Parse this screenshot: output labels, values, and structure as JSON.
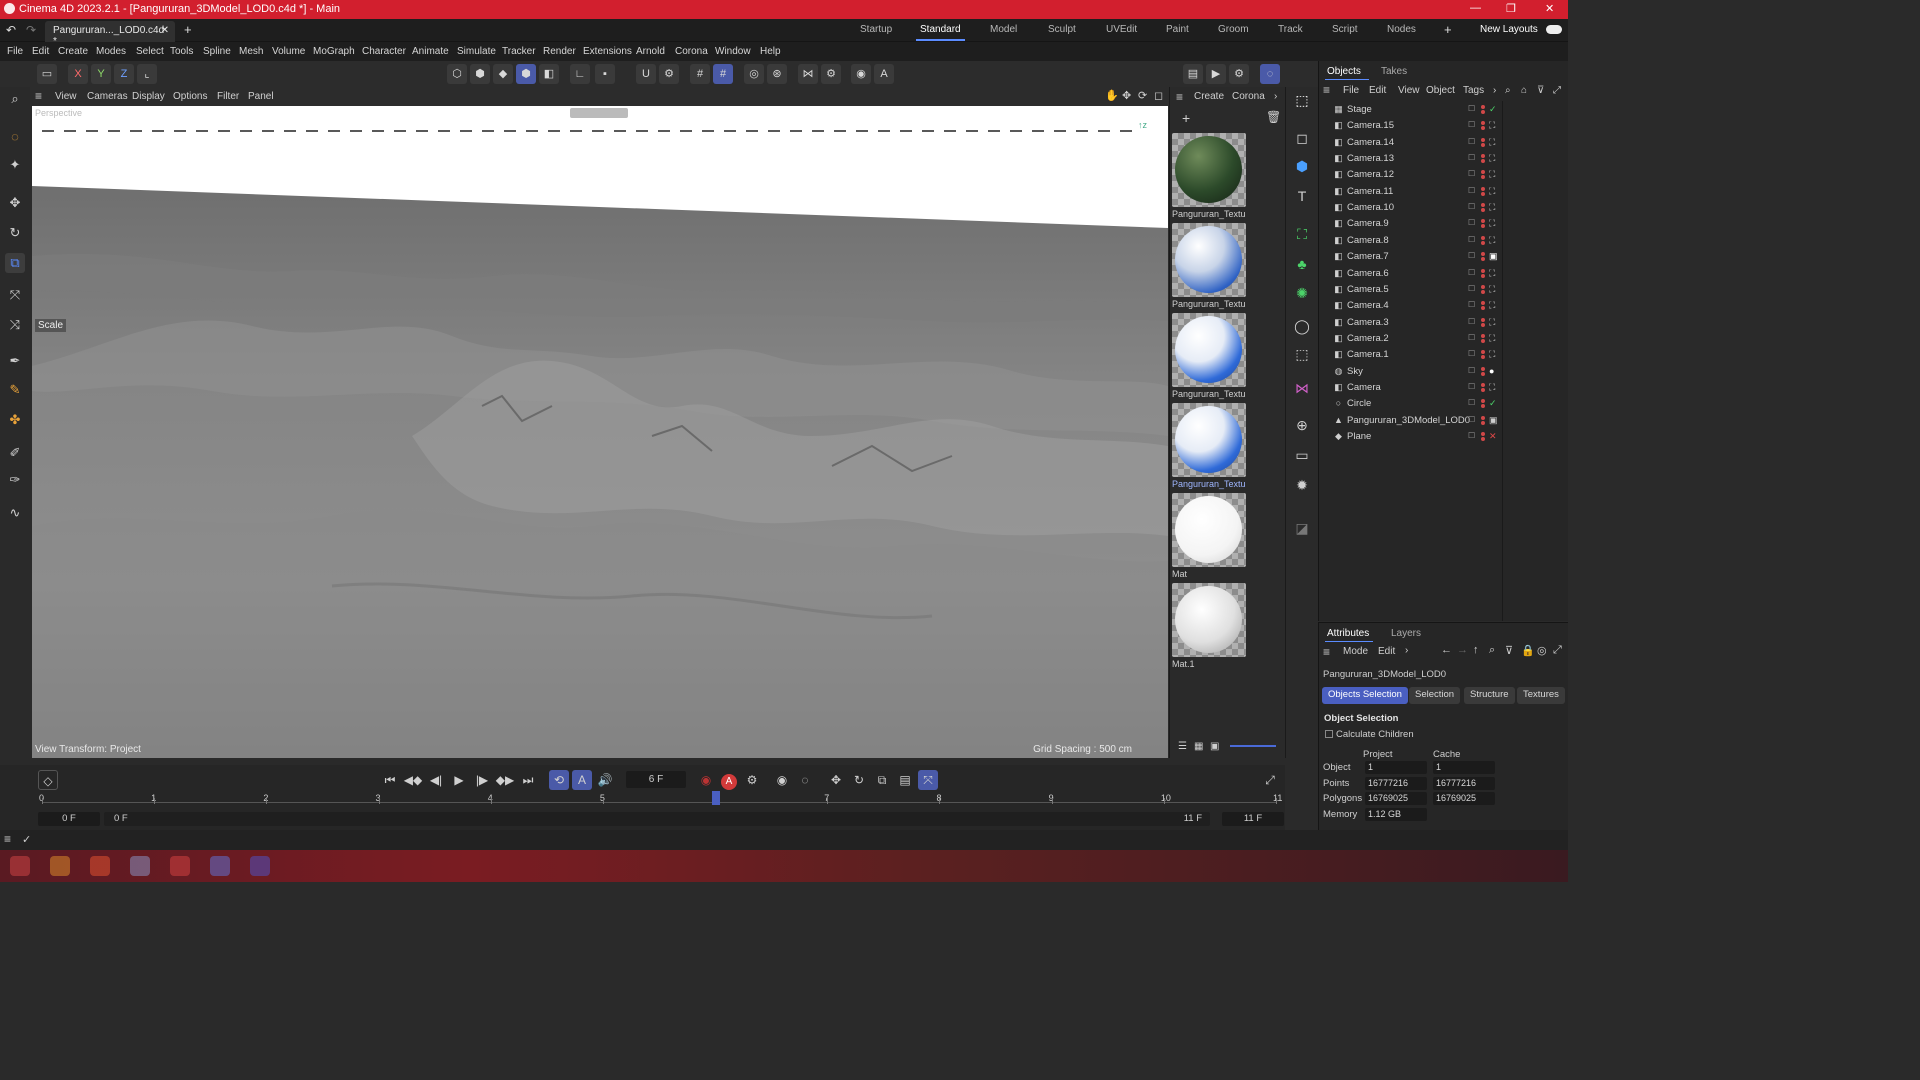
{
  "window": {
    "title": "Cinema 4D 2023.2.1 - [Pangururan_3DModel_LOD0.c4d *] - Main",
    "doc_tab": "Pangururan..._LOD0.c4d *"
  },
  "layouts": {
    "items": [
      "Startup",
      "Standard",
      "Model",
      "Sculpt",
      "UVEdit",
      "Paint",
      "Groom",
      "Track",
      "Script",
      "Nodes"
    ],
    "active": "Standard",
    "new_layouts": "New Layouts"
  },
  "menu": [
    "File",
    "Edit",
    "Create",
    "Modes",
    "Select",
    "Tools",
    "Spline",
    "Mesh",
    "Volume",
    "MoGraph",
    "Character",
    "Animate",
    "Simulate",
    "Tracker",
    "Render",
    "Extensions",
    "Arnold",
    "Corona",
    "Window",
    "Help"
  ],
  "axis_buttons": [
    "X",
    "Y",
    "Z"
  ],
  "viewport": {
    "menu": [
      "View",
      "Cameras",
      "Display",
      "Options",
      "Filter",
      "Panel"
    ],
    "camera_label": "Perspective",
    "tool_label": "Scale",
    "view_transform": "View Transform: Project",
    "grid_spacing": "Grid Spacing : 500 cm"
  },
  "material_manager": {
    "menu": [
      "Create",
      "Corona"
    ],
    "materials": [
      {
        "name": "Pangururan_Textu",
        "kind": "textured-green"
      },
      {
        "name": "Pangururan_Textu",
        "kind": "blue-white"
      },
      {
        "name": "Pangururan_Textu",
        "kind": "blue-white"
      },
      {
        "name": "Pangururan_Textu",
        "kind": "blue-white",
        "selected": true
      },
      {
        "name": "Mat",
        "kind": "white"
      },
      {
        "name": "Mat.1",
        "kind": "white-grey"
      }
    ]
  },
  "objects_panel": {
    "tabs": [
      "Objects",
      "Takes"
    ],
    "menu": [
      "File",
      "Edit",
      "View",
      "Object",
      "Tags"
    ],
    "objects": [
      {
        "name": "Stage",
        "icon": "stage-icon",
        "tag": "check"
      },
      {
        "name": "Camera.15",
        "icon": "camera-icon",
        "tag": "target"
      },
      {
        "name": "Camera.14",
        "icon": "camera-icon",
        "tag": "target"
      },
      {
        "name": "Camera.13",
        "icon": "camera-icon",
        "tag": "target"
      },
      {
        "name": "Camera.12",
        "icon": "camera-icon",
        "tag": "target"
      },
      {
        "name": "Camera.11",
        "icon": "camera-icon",
        "tag": "target"
      },
      {
        "name": "Camera.10",
        "icon": "camera-icon",
        "tag": "target"
      },
      {
        "name": "Camera.9",
        "icon": "camera-icon",
        "tag": "target"
      },
      {
        "name": "Camera.8",
        "icon": "camera-icon",
        "tag": "target"
      },
      {
        "name": "Camera.7",
        "icon": "camera-icon",
        "tag": "target-active"
      },
      {
        "name": "Camera.6",
        "icon": "camera-icon",
        "tag": "target"
      },
      {
        "name": "Camera.5",
        "icon": "camera-icon",
        "tag": "target"
      },
      {
        "name": "Camera.4",
        "icon": "camera-icon",
        "tag": "target"
      },
      {
        "name": "Camera.3",
        "icon": "camera-icon",
        "tag": "target"
      },
      {
        "name": "Camera.2",
        "icon": "camera-icon",
        "tag": "target"
      },
      {
        "name": "Camera.1",
        "icon": "camera-icon",
        "tag": "target"
      },
      {
        "name": "Sky",
        "icon": "sky-icon",
        "tag": "sphere"
      },
      {
        "name": "Camera",
        "icon": "camera-icon",
        "tag": "target"
      },
      {
        "name": "Circle",
        "icon": "circle-icon",
        "tag": "check"
      },
      {
        "name": "Pangururan_3DModel_LOD0",
        "icon": "polygon-icon",
        "tag": "material"
      },
      {
        "name": "Plane",
        "icon": "plane-icon",
        "tag": "cross"
      }
    ]
  },
  "attributes_panel": {
    "tabs": [
      "Attributes",
      "Layers"
    ],
    "menu": [
      "Mode",
      "Edit"
    ],
    "object_name": "Pangururan_3DModel_LOD0",
    "subtabs": [
      "Objects Selection",
      "Selection",
      "Structure",
      "Textures"
    ],
    "section_title": "Object Selection",
    "checkbox_label": "Calculate Children",
    "col_project": "Project",
    "col_cache": "Cache",
    "rows": [
      {
        "label": "Object",
        "project": "1",
        "cache": "1"
      },
      {
        "label": "Points",
        "project": "16777216",
        "cache": "16777216"
      },
      {
        "label": "Polygons",
        "project": "16769025",
        "cache": "16769025"
      },
      {
        "label": "Memory",
        "project": "1.12 GB",
        "cache": ""
      }
    ]
  },
  "timeline": {
    "current_frame": "6 F",
    "ticks": [
      "0",
      "1",
      "2",
      "3",
      "4",
      "5",
      "6",
      "7",
      "8",
      "9",
      "10",
      "11"
    ],
    "start_a": "0 F",
    "start_b": "0 F",
    "end_a": "11 F",
    "end_b": "11 F"
  },
  "colors": {
    "titlebar": "#d21f2e",
    "accent": "#5b8cff",
    "selected_tab": "#4a5fc1"
  }
}
